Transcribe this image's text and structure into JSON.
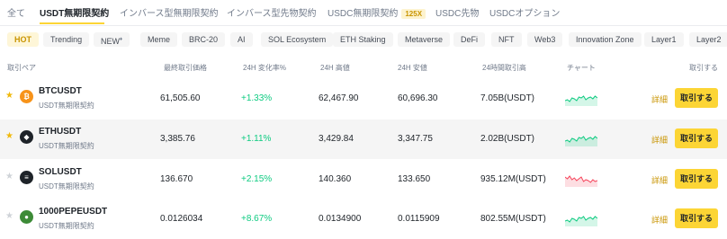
{
  "tabs": [
    {
      "label": "全て"
    },
    {
      "label": "USDT無期限契約"
    },
    {
      "label": "インバース型無期限契約"
    },
    {
      "label": "インバース型先物契約"
    },
    {
      "label": "USDC無期限契約",
      "badge": "125X"
    },
    {
      "label": "USDC先物"
    },
    {
      "label": "USDCオプション"
    }
  ],
  "chips": [
    {
      "label": "HOT"
    },
    {
      "label": "Trending"
    },
    {
      "label": "NEW",
      "mark": "♦"
    },
    {
      "label": "Meme"
    },
    {
      "label": "BRC-20"
    },
    {
      "label": "AI"
    },
    {
      "label": "SOL Ecosystem"
    },
    {
      "label": "ETH Staking"
    },
    {
      "label": "Metaverse"
    },
    {
      "label": "DeFi"
    },
    {
      "label": "NFT"
    },
    {
      "label": "Web3"
    },
    {
      "label": "Innovation Zone"
    },
    {
      "label": "Layer1"
    },
    {
      "label": "Layer2"
    }
  ],
  "table": {
    "headers": {
      "pair": "取引ペア",
      "last_price": "最終取引価格",
      "change": "24H 変化率%",
      "high": "24H 高値",
      "low": "24H 安値",
      "volume": "24時間取引高",
      "chart": "チャート",
      "action": "取引する"
    },
    "rows": [
      {
        "symbol": "BTCUSDT",
        "sub": "USDT無期限契約",
        "coin_glyph": "₿",
        "coin_color": "#f7931a",
        "favorite": true,
        "last_price": "61,505.60",
        "change": "+1.33%",
        "high": "62,467.90",
        "low": "60,696.30",
        "volume": "7.05B(USDT)",
        "trend": "up",
        "spark_color": "#0ecb81",
        "detail": "詳細",
        "trade": "取引する"
      },
      {
        "symbol": "ETHUSDT",
        "sub": "USDT無期限契約",
        "coin_glyph": "◆",
        "coin_color": "#1e2329",
        "favorite": true,
        "last_price": "3,385.76",
        "change": "+1.11%",
        "high": "3,429.84",
        "low": "3,347.75",
        "volume": "2.02B(USDT)",
        "trend": "up",
        "spark_color": "#0ecb81",
        "detail": "詳細",
        "trade": "取引する"
      },
      {
        "symbol": "SOLUSDT",
        "sub": "USDT無期限契約",
        "coin_glyph": "≡",
        "coin_color": "#1e2329",
        "favorite": false,
        "last_price": "136.670",
        "change": "+2.15%",
        "high": "140.360",
        "low": "133.650",
        "volume": "935.12M(USDT)",
        "trend": "down",
        "spark_color": "#f6465d",
        "detail": "詳細",
        "trade": "取引する"
      },
      {
        "symbol": "1000PEPEUSDT",
        "sub": "USDT無期限契約",
        "coin_glyph": "●",
        "coin_color": "#3d8b37",
        "favorite": false,
        "last_price": "0.0126034",
        "change": "+8.67%",
        "high": "0.0134900",
        "low": "0.0115909",
        "volume": "802.55M(USDT)",
        "trend": "up",
        "spark_color": "#0ecb81",
        "detail": "詳細",
        "trade": "取引する"
      }
    ]
  }
}
